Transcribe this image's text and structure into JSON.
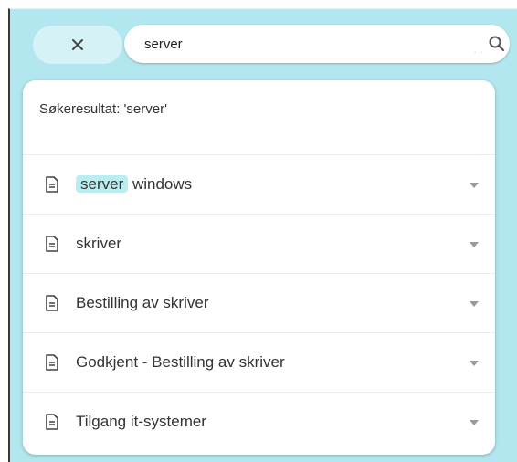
{
  "search": {
    "value": "server",
    "dots": ". .",
    "close_icon": "close-icon",
    "search_icon": "search-icon"
  },
  "results": {
    "heading": "Søkeresultat: 'server'",
    "items": [
      {
        "highlight": "server",
        "rest": " windows"
      },
      {
        "highlight": "",
        "rest": "skriver"
      },
      {
        "highlight": "",
        "rest": "Bestilling av skriver"
      },
      {
        "highlight": "",
        "rest": "Godkjent - Bestilling av skriver"
      },
      {
        "highlight": "",
        "rest": "Tilgang it-systemer"
      }
    ]
  },
  "colors": {
    "background": "#b3e7ef",
    "close_button": "#d5f3f6",
    "highlight": "#b8eef2"
  }
}
